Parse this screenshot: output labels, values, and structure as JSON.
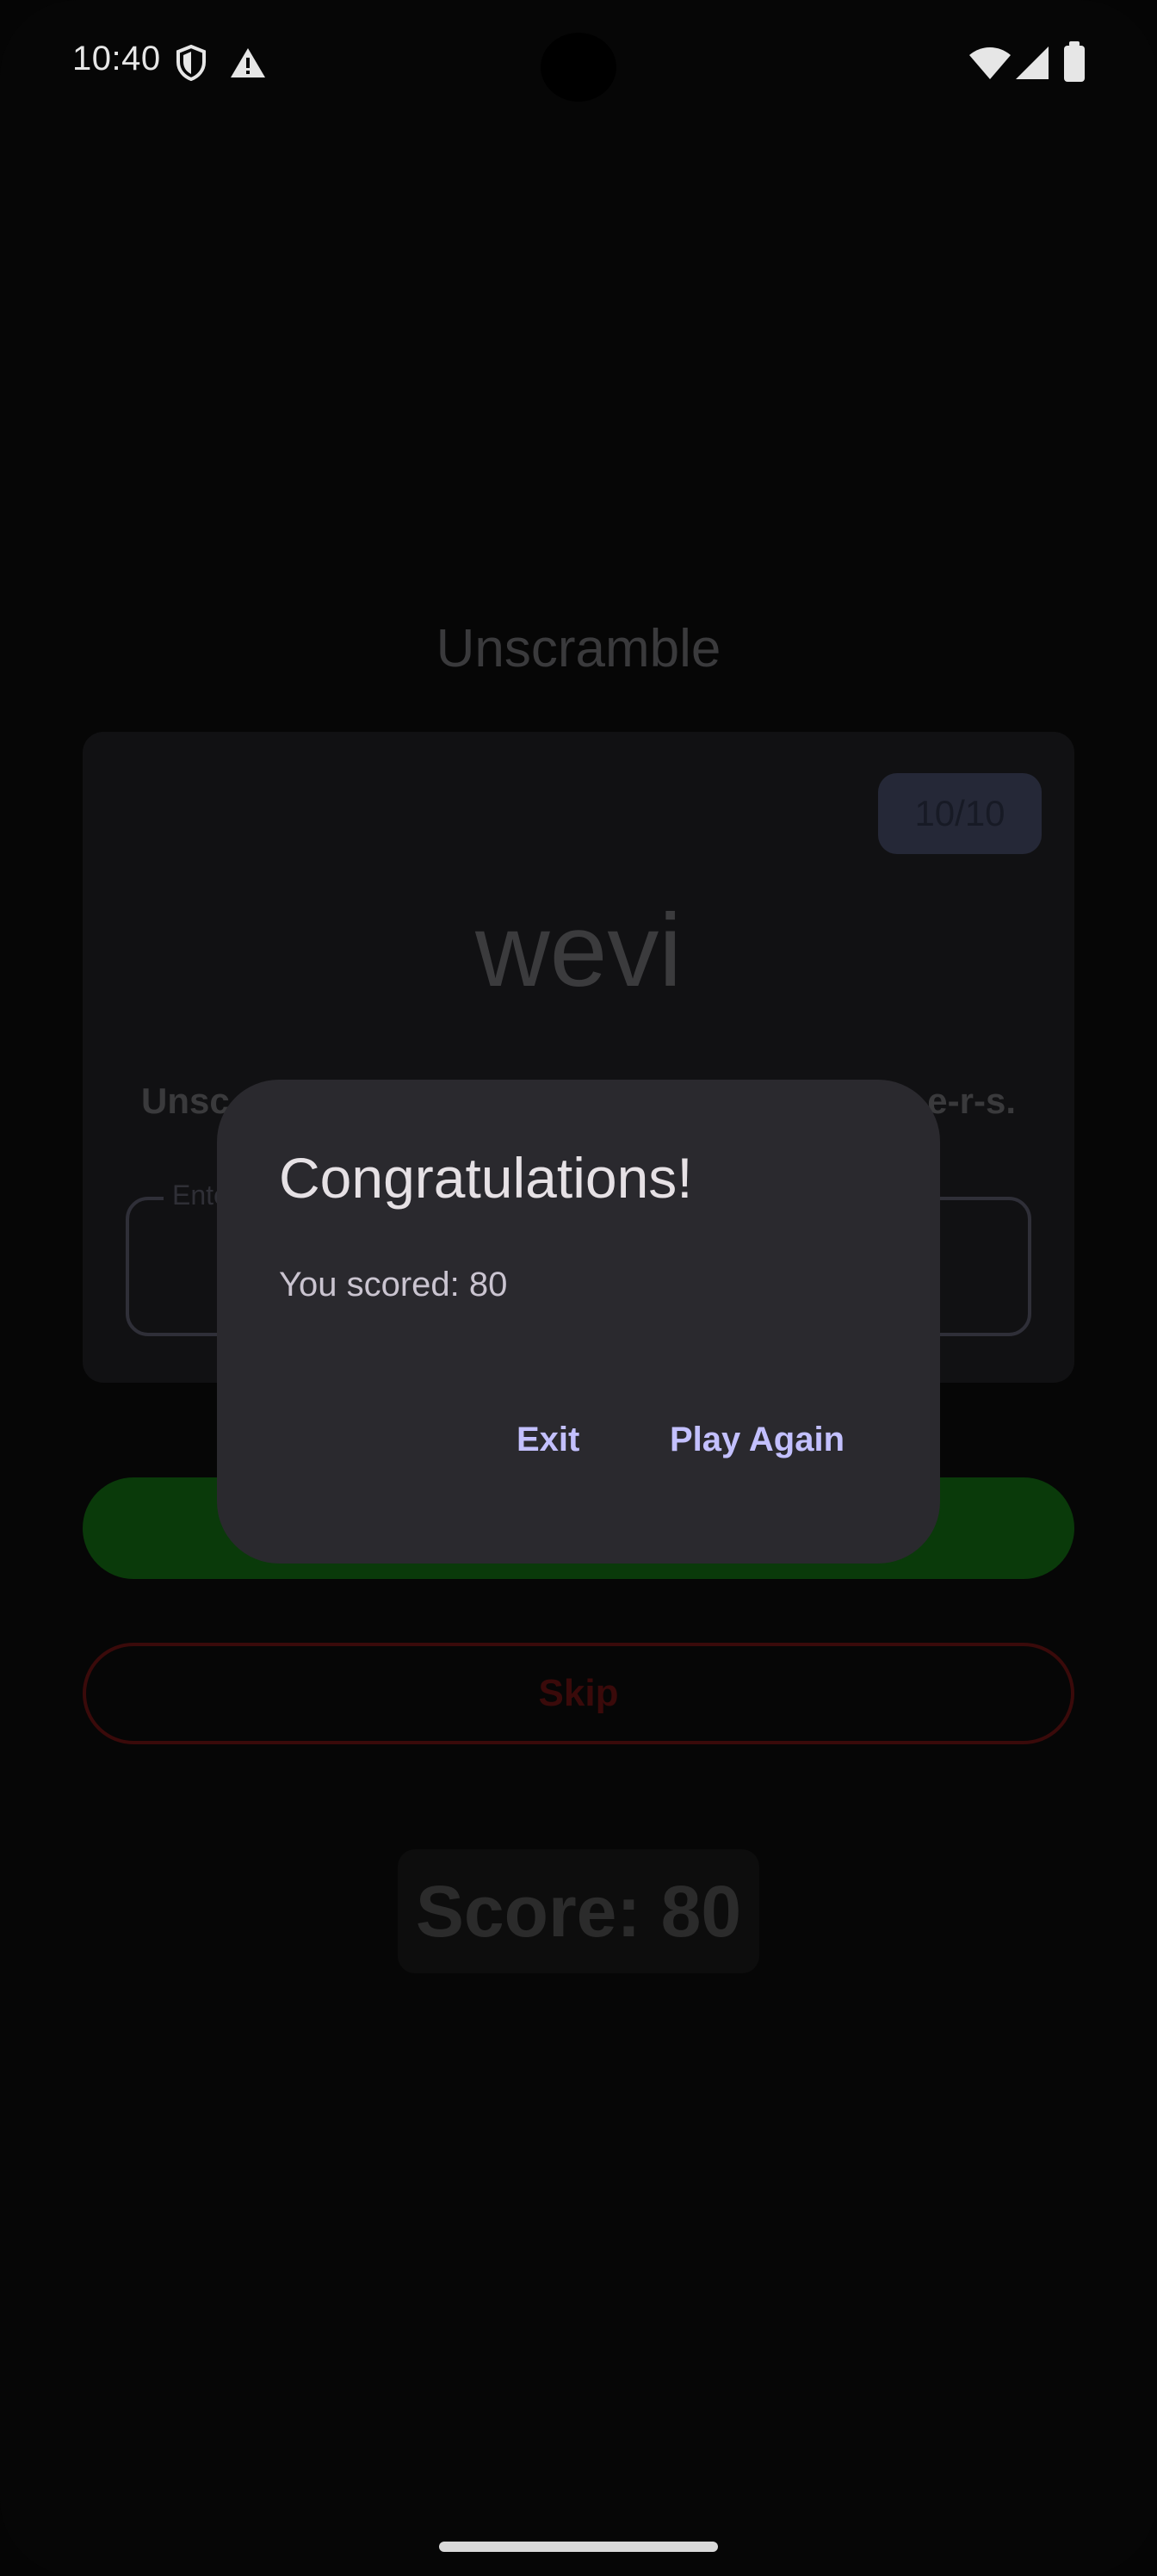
{
  "status_bar": {
    "time": "10:40",
    "icons_left": [
      "shield-icon",
      "warning-icon"
    ],
    "icons_right": [
      "wifi-icon",
      "signal-icon",
      "battery-icon"
    ]
  },
  "app": {
    "title": "Unscramble",
    "counter": "10/10",
    "scrambled_word": "wevi",
    "instructions": "Unscramble the word using all the l-e-t-t-e-r-s.",
    "instructions_visible_left": "Unsc",
    "instructions_visible_right": "e-r-s.",
    "input_label": "Ente",
    "skip_label": "Skip",
    "score": "Score: 80"
  },
  "dialog": {
    "title": "Congratulations!",
    "message": "You scored: 80",
    "exit_label": "Exit",
    "play_again_label": "Play Again"
  },
  "colors": {
    "dialog_bg": "#2a292e",
    "accent_text": "#c3c0ff",
    "submit_green": "#0a3a0a",
    "skip_red": "#3a0a0a"
  }
}
